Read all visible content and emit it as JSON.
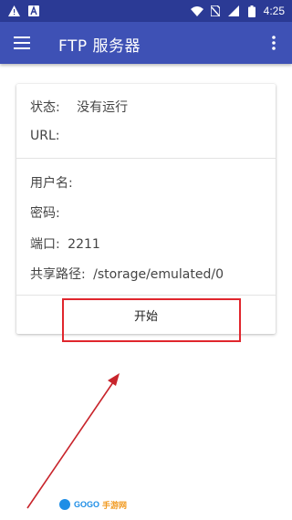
{
  "status_bar": {
    "time": "4:25",
    "icons": [
      "warning-icon",
      "font-icon",
      "wifi-icon",
      "no-sim-icon",
      "signal-icon",
      "battery-icon"
    ]
  },
  "app_bar": {
    "title": "FTP 服务器",
    "menu_icon": "hamburger-menu-icon",
    "overflow_icon": "more-vert-icon",
    "color": "#3e51b5"
  },
  "card": {
    "status_label": "状态:",
    "status_value": "没有运行",
    "url_label": "URL:",
    "username_label": "用户名:",
    "password_label": "密码:",
    "port_label": "端口:",
    "port_value": "2211",
    "share_path_label": "共享路径:",
    "share_path_value": "/storage/emulated/0",
    "start_button": "开始"
  },
  "annotation": {
    "highlight_color": "#e0262d"
  },
  "watermark": {
    "text_a": "GOGO",
    "text_b": "手游网"
  }
}
